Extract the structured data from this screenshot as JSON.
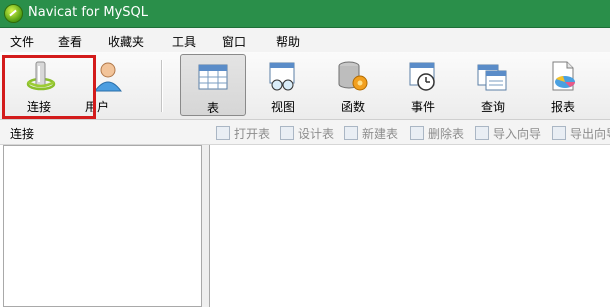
{
  "window": {
    "title": "Navicat for MySQL"
  },
  "menu": {
    "items": [
      "文件",
      "查看",
      "收藏夹",
      "工具",
      "窗口",
      "帮助"
    ]
  },
  "toolbar": {
    "buttons": [
      {
        "label": "连接",
        "icon": "connection-icon"
      },
      {
        "label": "用户",
        "icon": "user-icon"
      },
      {
        "label": "表",
        "icon": "table-icon",
        "active": true
      },
      {
        "label": "视图",
        "icon": "view-icon"
      },
      {
        "label": "函数",
        "icon": "function-icon"
      },
      {
        "label": "事件",
        "icon": "event-icon"
      },
      {
        "label": "查询",
        "icon": "query-icon"
      },
      {
        "label": "报表",
        "icon": "report-icon"
      }
    ]
  },
  "left_pane": {
    "title": "连接"
  },
  "object_toolbar": {
    "buttons": [
      "打开表",
      "设计表",
      "新建表",
      "删除表",
      "导入向导",
      "导出向导"
    ]
  },
  "colors": {
    "titlebar": "#2a8f4a",
    "highlight": "#d31b1b"
  }
}
